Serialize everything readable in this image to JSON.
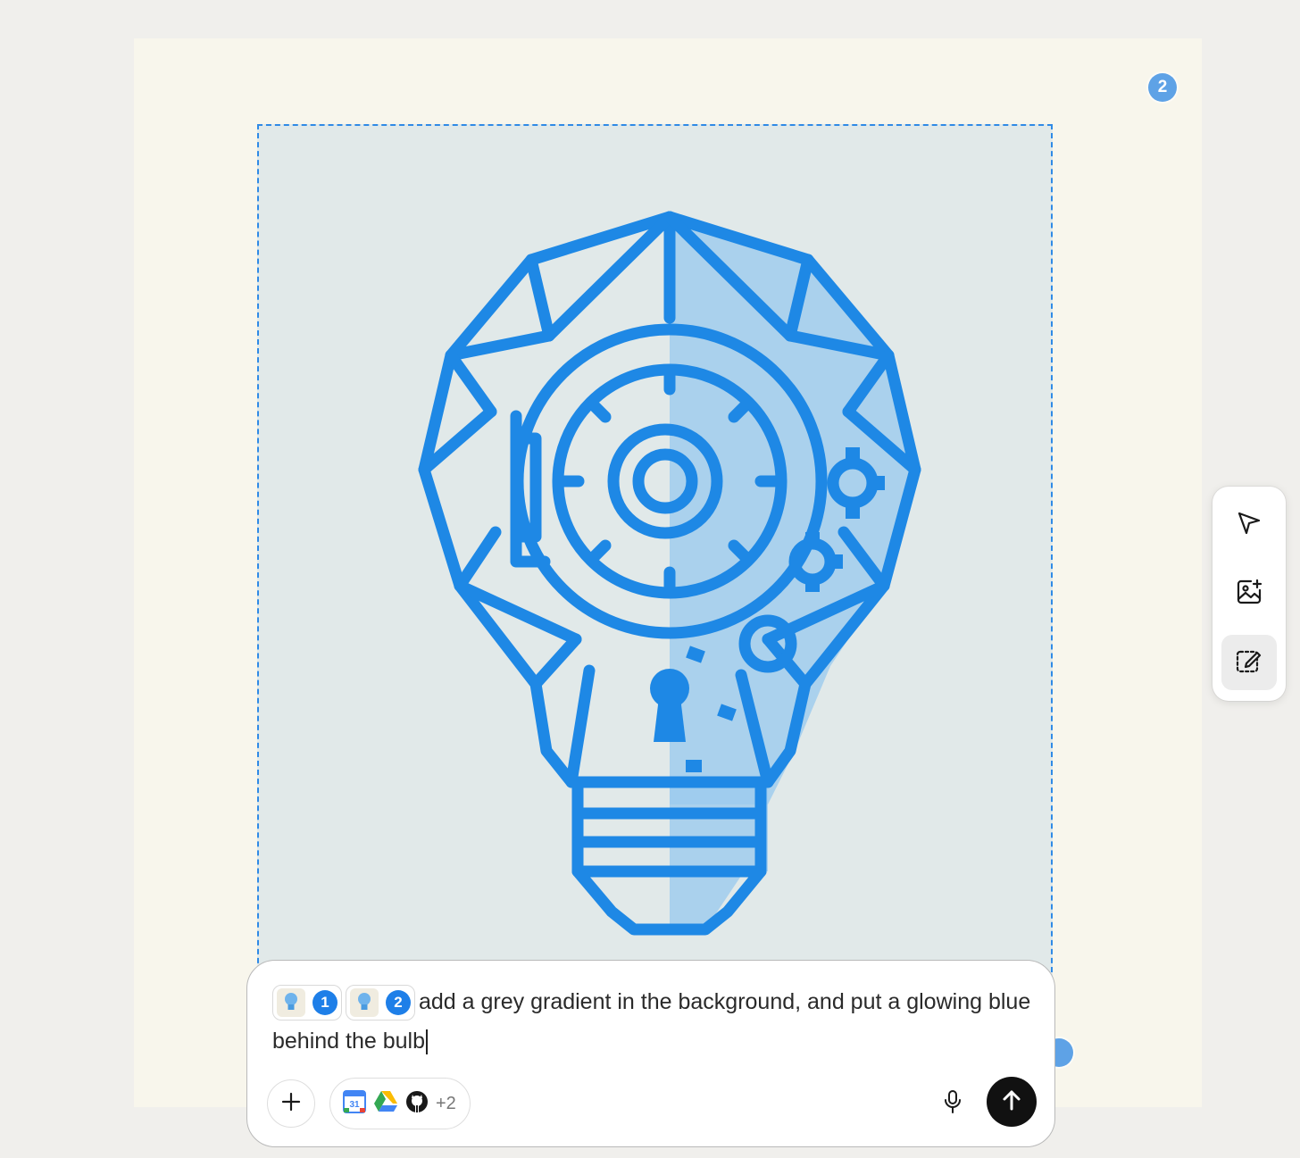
{
  "markers": {
    "badge_2": "2"
  },
  "colors": {
    "accent": "#1e88e5",
    "selection_border": "#2f8ae6",
    "send_button": "#111111",
    "canvas_bg": "#f8f6ec",
    "image_bg": "#e1e9e9"
  },
  "toolbar": {
    "tools": [
      {
        "icon": "cursor-pointer-icon"
      },
      {
        "icon": "image-add-icon"
      },
      {
        "icon": "select-edit-icon",
        "active": true
      }
    ]
  },
  "composer": {
    "chips": [
      {
        "number": "1"
      },
      {
        "number": "2"
      }
    ],
    "prompt_text": "add a grey gradient in the background, and put a glowing blue behind the bulb",
    "connectors_more": "+2",
    "connector_icons": [
      "google-calendar-icon",
      "google-drive-icon",
      "github-icon"
    ],
    "calendar_day": "31"
  }
}
